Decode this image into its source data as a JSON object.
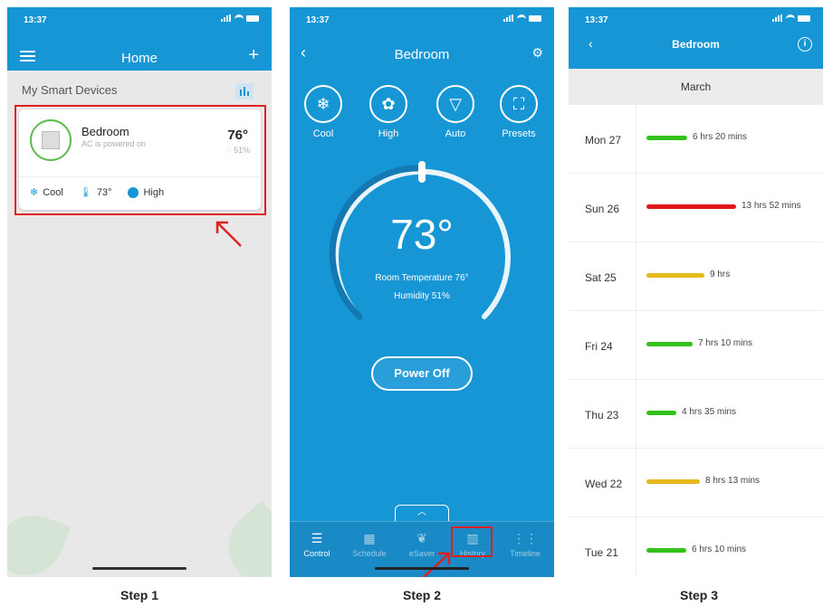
{
  "status_time": "13:37",
  "step_labels": [
    "Step 1",
    "Step 2",
    "Step 3"
  ],
  "screen1": {
    "title": "Home",
    "section_title": "My Smart Devices",
    "device": {
      "name": "Bedroom",
      "status": "AC is powered on",
      "temperature": "76°",
      "humidity": "51%",
      "mode": "Cool",
      "setpoint": "73°",
      "fan": "High"
    }
  },
  "screen2": {
    "title": "Bedroom",
    "modes": [
      {
        "label": "Cool",
        "icon": "snowflake-icon"
      },
      {
        "label": "High",
        "icon": "fan-icon"
      },
      {
        "label": "Auto",
        "icon": "auto-icon"
      },
      {
        "label": "Presets",
        "icon": "presets-icon"
      }
    ],
    "setpoint": "73°",
    "room_temperature": "Room Temperature 76°",
    "humidity": "Humidity 51%",
    "power_button": "Power Off",
    "nav": [
      {
        "label": "Control",
        "icon": "sliders-icon",
        "active": true
      },
      {
        "label": "Schedule",
        "icon": "calendar-icon",
        "active": false
      },
      {
        "label": "eSaver",
        "icon": "leaf-icon",
        "active": false
      },
      {
        "label": "History",
        "icon": "bar-chart-icon",
        "active": false
      },
      {
        "label": "Timeline",
        "icon": "timeline-icon",
        "active": false
      }
    ]
  },
  "screen3": {
    "title": "Bedroom",
    "month": "March",
    "days": [
      {
        "day": "Mon 27",
        "duration": "6 hrs 20 mins",
        "hours": 6.33,
        "color": "#33c21a"
      },
      {
        "day": "Sun 26",
        "duration": "13 hrs 52 mins",
        "hours": 13.87,
        "color": "#e0171b"
      },
      {
        "day": "Sat 25",
        "duration": "9 hrs",
        "hours": 9.0,
        "color": "#e6b81a"
      },
      {
        "day": "Fri 24",
        "duration": "7 hrs 10 mins",
        "hours": 7.17,
        "color": "#33c21a"
      },
      {
        "day": "Thu 23",
        "duration": "4 hrs 35 mins",
        "hours": 4.58,
        "color": "#33c21a"
      },
      {
        "day": "Wed 22",
        "duration": "8 hrs 13 mins",
        "hours": 8.22,
        "color": "#e6b81a"
      },
      {
        "day": "Tue 21",
        "duration": "6 hrs 10 mins",
        "hours": 6.17,
        "color": "#33c21a"
      }
    ]
  },
  "colors": {
    "brand_blue": "#1796d6",
    "highlight_red": "#e02020"
  }
}
